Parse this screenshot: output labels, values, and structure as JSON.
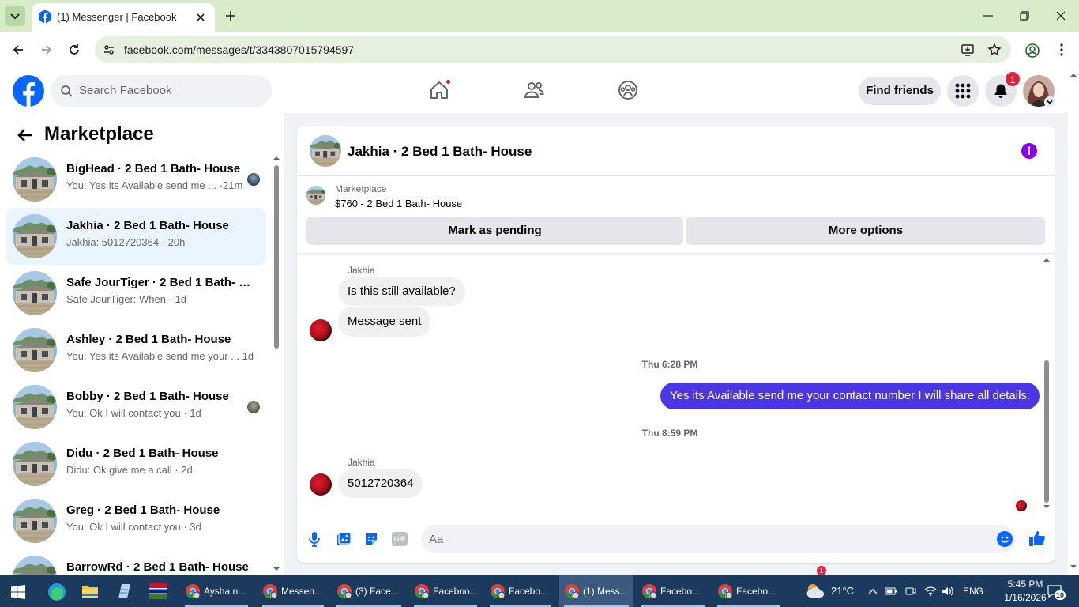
{
  "browser": {
    "tab_title": "(1) Messenger | Facebook",
    "url": "facebook.com/messages/t/3343807015794597"
  },
  "fb_header": {
    "search_placeholder": "Search Facebook",
    "find_friends": "Find friends",
    "notification_count": "1"
  },
  "left_panel": {
    "title": "Marketplace",
    "conversations": [
      {
        "name": "BigHead · 2 Bed 1 Bath- House",
        "preview": "You: Yes its Available send me ... ·21m",
        "selected": false
      },
      {
        "name": "Jakhia · 2 Bed 1 Bath- House",
        "preview": "Jakhia: 5012720364 · 20h",
        "selected": true
      },
      {
        "name": "Safe JourTiger · 2 Bed 1 Bath- H...",
        "preview": "Safe JourTiger: When · 1d",
        "selected": false
      },
      {
        "name": "Ashley · 2 Bed 1 Bath- House",
        "preview": "You: Yes its Available send me your ...  1d",
        "selected": false
      },
      {
        "name": "Bobby · 2 Bed 1 Bath- House",
        "preview": "You: Ok I will contact you · 1d",
        "selected": false
      },
      {
        "name": "Didu · 2 Bed 1 Bath- House",
        "preview": "Didu: Ok give me a call · 2d",
        "selected": false
      },
      {
        "name": "Greg · 2 Bed 1 Bath- House",
        "preview": "You: Ok I will contact you · 3d",
        "selected": false
      },
      {
        "name": "BarrowRd · 2 Bed 1 Bath- House",
        "preview": "",
        "selected": false
      }
    ]
  },
  "chat": {
    "title": "Jakhia · 2 Bed 1 Bath- House",
    "listing_label": "Marketplace",
    "listing_price": "$760 - 2 Bed 1 Bath- House",
    "mark_pending": "Mark as pending",
    "more_options": "More options",
    "messages": {
      "sender1": "Jakhia",
      "m1": "Is this still available?",
      "m2": "Message sent",
      "ts1": "Thu 6:28 PM",
      "m3": "Yes its Available send me your contact number I will share all details.",
      "ts2": "Thu 8:59 PM",
      "sender2": "Jakhia",
      "m4": "5012720364"
    },
    "composer_placeholder": "Aa",
    "gif_label": "GIF"
  },
  "taskbar": {
    "items": [
      {
        "label": "Aysha n..."
      },
      {
        "label": "Messen..."
      },
      {
        "label": "(3) Face..."
      },
      {
        "label": "Faceboo..."
      },
      {
        "label": "Facebo..."
      },
      {
        "label": "(1) Mess..."
      },
      {
        "label": "Facebo..."
      },
      {
        "label": "Facebo..."
      }
    ],
    "weather": "21°C",
    "weather_badge": "1",
    "lang": "ENG",
    "time": "5:45 PM",
    "date": "1/16/2026",
    "notif_count": "10"
  },
  "colors": {
    "fb_blue": "#0866ff",
    "outgoing_bubble": "#4b36e4",
    "browser_theme": "#d8ecc9"
  }
}
